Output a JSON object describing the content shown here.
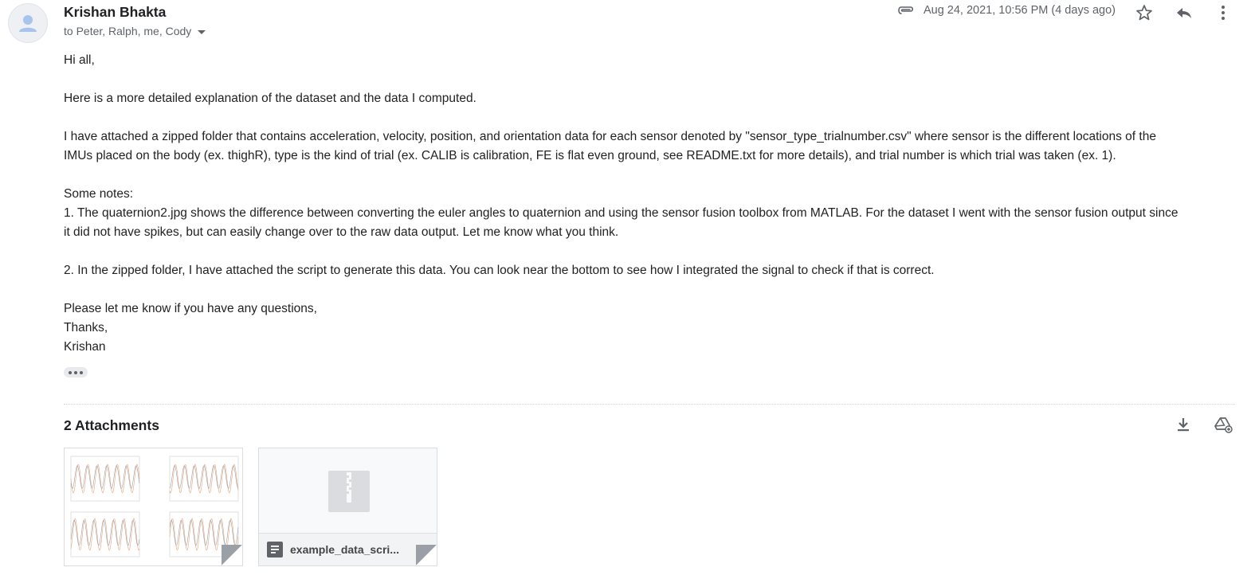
{
  "sender": {
    "name": "Krishan Bhakta"
  },
  "recipients": {
    "text": "to Peter, Ralph, me, Cody"
  },
  "meta": {
    "date": "Aug 24, 2021, 10:56 PM (4 days ago)"
  },
  "icons": {
    "attachment": "paperclip-icon",
    "star": "star-icon",
    "reply": "reply-icon",
    "more": "more-vert-icon",
    "download": "download-icon",
    "drive": "add-to-drive-icon"
  },
  "body": {
    "greeting": "Hi all,",
    "intro": "Here is a more detailed explanation of the dataset and the data I computed.",
    "para1_line1": "I have attached a zipped folder that contains acceleration, velocity, position, and orientation data for each sensor denoted by \"sensor_type_trialnumber.csv\" where sensor is the different locations of the",
    "para1_line2": "IMUs placed on the body (ex. thighR), type is the kind of trial (ex. CALIB is calibration, FE is flat even ground, see README.txt for more details), and trial number is which trial was taken (ex. 1).",
    "notes_heading": "Some notes:",
    "note1_line1": "1. The quaternion2.jpg shows the difference between converting the euler angles to quaternion and using the sensor fusion toolbox from MATLAB. For the dataset I went with the sensor fusion output since",
    "note1_line2": "it did not have spikes, but can easily change over to the raw data output. Let me know what you think.",
    "note2": "2. In the zipped folder, I have attached the script to generate this data. You can look near the bottom to see how I integrated the signal to check if that is correct.",
    "closing1": "Please let me know if you have any questions,",
    "closing2": "Thanks,",
    "signature": "Krishan"
  },
  "attachments": {
    "title": "2 Attachments",
    "items": [
      {
        "type": "image",
        "kind": "plot-thumbnail"
      },
      {
        "type": "zip",
        "name": "example_data_scri..."
      }
    ]
  },
  "colors": {
    "accent_grey": "#5f6368",
    "text": "#222222",
    "trace_orange": "#e8a37a",
    "trace_grey": "#9aa0a6"
  }
}
